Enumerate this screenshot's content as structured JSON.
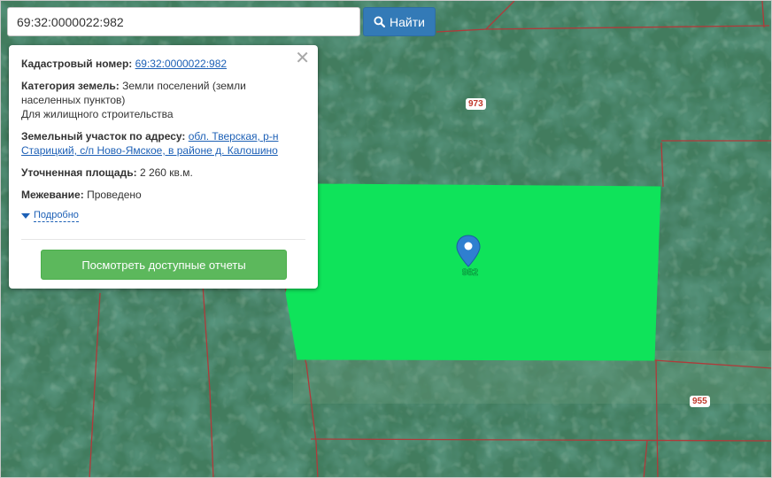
{
  "search": {
    "value": "69:32:0000022:982",
    "button_label": "Найти"
  },
  "popup": {
    "cadastral_label": "Кадастровый номер:",
    "cadastral_value": "69:32:0000022:982",
    "category_label": "Категория земель:",
    "category_value": "Земли поселений (земли населенных пунктов)",
    "category_use": "Для жилищного строительства",
    "address_label": "Земельный участок по адресу:",
    "address_value": "обл. Тверская, р-н Старицкий, с/п Ново-Ямское, в районе д. Калошино",
    "area_label": "Уточненная площадь:",
    "area_value": "2 260 кв.м.",
    "survey_label": "Межевание:",
    "survey_value": "Проведено",
    "more_label": "Подробно",
    "report_button": "Посмотреть доступные отчеты"
  },
  "map": {
    "parcel_labels": [
      "973",
      "955"
    ],
    "marker_label": "982",
    "parcel_color": "#0fe35a",
    "boundary_color": "#b03a3a"
  }
}
